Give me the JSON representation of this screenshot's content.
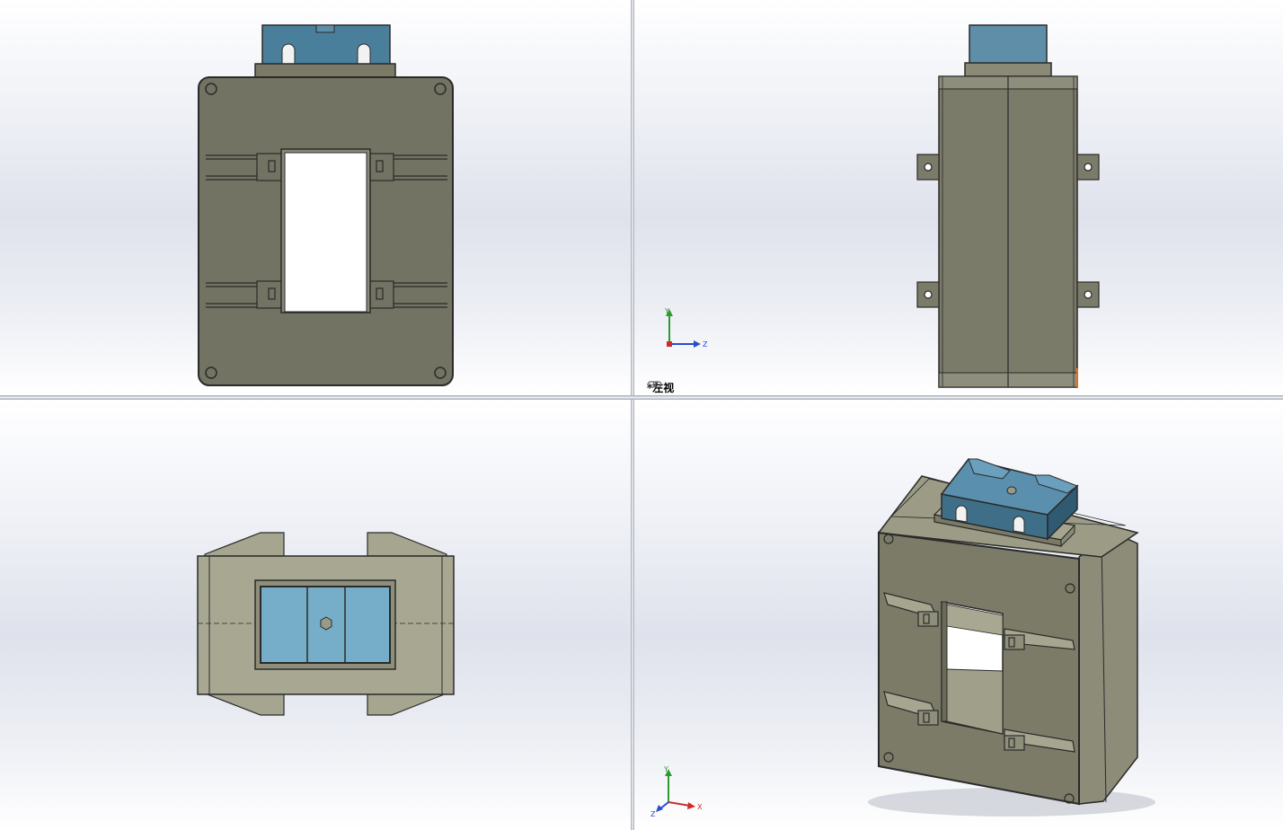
{
  "viewports": {
    "front": {
      "name": "front-view"
    },
    "left": {
      "name": "left-view",
      "label": "*左视",
      "triad": {
        "y": "Y",
        "z": "Z"
      }
    },
    "top": {
      "name": "top-view"
    },
    "iso": {
      "name": "isometric-view",
      "triad": {
        "y": "Y",
        "x": "X",
        "z": "Z"
      }
    }
  },
  "icons": {
    "view_link": "link-icon",
    "triad": "coordinate-triad-icon"
  },
  "colors": {
    "body": "#7a7a66",
    "body_light": "#a6a690",
    "terminal": "#4a7f9c",
    "terminal_light": "#79b2cc",
    "outline": "#2a2a2a",
    "triad_y": "#2f9a2f",
    "triad_x": "#d02a2a",
    "triad_z": "#2a4ad0"
  }
}
